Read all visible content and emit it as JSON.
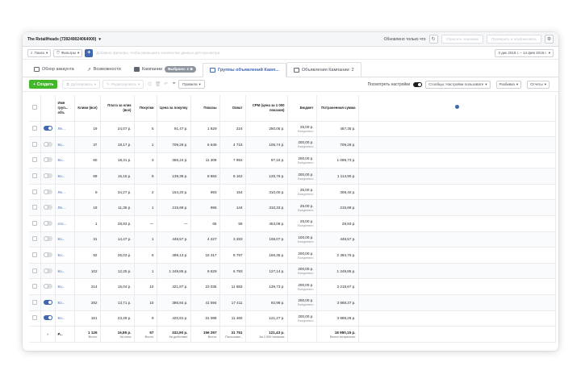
{
  "topbar": {
    "account": "The RetailHeads (739249024064000)",
    "changes_label": "Обновлено только что",
    "discard_label": "Сбросить черновик",
    "publish_label": "Проверить и опубликовать"
  },
  "filterbar": {
    "search_label": "Поиск",
    "filters_label": "Фильтры",
    "hint": "Добавьте фильтры, чтобы уменьшить количество данных для просмотра",
    "date_range": "3 дек 2018 г. – 14 фев 2019 г."
  },
  "tabs": {
    "overview": "Обзор аккаунта",
    "opportunities": "Возможности",
    "campaigns": "Кампании",
    "selected_badge": "Выбрано: 2",
    "adsets": "Группы объявлений Камп...",
    "ads": "Объявления Кампании: 2"
  },
  "toolbar": {
    "create": "Создать",
    "duplicate": "Дублировать",
    "edit": "Редактировать",
    "rules": "Правила",
    "view_settings": "Посмотреть настройки",
    "columns": "Столбцы: Настройки пользовате",
    "breakdown": "Разбивка",
    "reports": "Отчеты"
  },
  "columns": {
    "name": "Имя груп... объ",
    "clicks": "Клики (все)",
    "cpc": "Плата за клик (все)",
    "purchases": "Покупки",
    "cost_per_purchase": "Цена за покупку",
    "impressions": "Показы",
    "reach": "Охват",
    "cpm": "CPM (цена за 1 000 показов)",
    "budget": "Бюджет",
    "spent": "Потраченная сумма"
  },
  "rows": [
    {
      "on": false,
      "name": "Ле...",
      "clicks": "19",
      "cpc": "24,07 р.",
      "purchases": "5",
      "cpp": "91,47 р.",
      "impressions": "1 829",
      "reach": "224",
      "cpm": "250,05 р.",
      "budget": "25,00 р.",
      "budget_sub": "Ежедневно",
      "spent": "457,35 р."
    },
    {
      "on": false,
      "name": "Ко...",
      "clicks": "37",
      "cpc": "19,17 р.",
      "purchases": "1",
      "cpp": "709,28 р.",
      "impressions": "6 646",
      "reach": "4 715",
      "cpm": "106,74 р.",
      "budget": "200,00 р.",
      "budget_sub": "Ежедневно",
      "spent": "709,28 р."
    },
    {
      "on": false,
      "name": "Ко...",
      "clicks": "60",
      "cpc": "18,31 р.",
      "purchases": "3",
      "cpp": "366,24 р.",
      "impressions": "11 309",
      "reach": "7 992",
      "cpm": "97,16 р.",
      "budget": "200,00 р.",
      "budget_sub": "Ежедневно",
      "spent": "1 098,73 р."
    },
    {
      "on": false,
      "name": "Ко...",
      "clicks": "69",
      "cpc": "16,16 р.",
      "purchases": "8",
      "cpp": "139,38 р.",
      "impressions": "8 884",
      "reach": "6 162",
      "cpm": "125,76 р.",
      "budget": "200,00 р.",
      "budget_sub": "Ежедневно",
      "spent": "1 114,90 р."
    },
    {
      "on": false,
      "name": "Ле...",
      "clicks": "9",
      "cpc": "34,27 р.",
      "purchases": "2",
      "cpp": "154,20 р.",
      "impressions": "993",
      "reach": "154",
      "cpm": "310,00 р.",
      "budget": "25,00 р.",
      "budget_sub": "Ежедневно",
      "spent": "308,40 р."
    },
    {
      "on": false,
      "name": "Ле...",
      "clicks": "19",
      "cpc": "11,35 р.",
      "purchases": "1",
      "cpp": "215,69 р.",
      "impressions": "695",
      "reach": "144",
      "cpm": "310,33 р.",
      "budget": "25,00 р.",
      "budget_sub": "Ежедневно",
      "spent": "215,69 р."
    },
    {
      "on": false,
      "name": "ото...",
      "clicks": "1",
      "cpc": "28,93 р.",
      "purchases": "—",
      "cpp": "—",
      "impressions": "65",
      "reach": "59",
      "cpm": "453,08 р.",
      "budget": "25,00 р.",
      "budget_sub": "Ежедневно",
      "spent": "28,93 р."
    },
    {
      "on": false,
      "name": "Ко...",
      "clicks": "31",
      "cpc": "14,47 р.",
      "purchases": "1",
      "cpp": "448,57 р.",
      "impressions": "4 227",
      "reach": "3 283",
      "cpm": "106,07 р.",
      "budget": "100,00 р.",
      "budget_sub": "Ежедневно",
      "spent": "448,57 р."
    },
    {
      "on": false,
      "name": "Ко...",
      "clicks": "92",
      "cpc": "26,03 р.",
      "purchases": "6",
      "cpp": "399,13 р.",
      "impressions": "15 317",
      "reach": "8 797",
      "cpm": "156,35 р.",
      "budget": "200,00 р.",
      "budget_sub": "Ежедневно",
      "spent": "2 394,76 р."
    },
    {
      "on": false,
      "name": "Ко...",
      "clicks": "102",
      "cpc": "12,25 р.",
      "purchases": "1",
      "cpp": "1 249,85 р.",
      "impressions": "9 829",
      "reach": "6 793",
      "cpm": "127,14 р.",
      "budget": "200,00 р.",
      "budget_sub": "Ежедневно",
      "spent": "1 249,85 р."
    },
    {
      "on": false,
      "name": "Ко...",
      "clicks": "214",
      "cpc": "15,04 р.",
      "purchases": "10",
      "cpp": "321,87 р.",
      "impressions": "23 035",
      "reach": "11 883",
      "cpm": "139,73 р.",
      "budget": "200,00 р.",
      "budget_sub": "Ежедневно",
      "spent": "3 218,67 р."
    },
    {
      "on": true,
      "name": "Ко...",
      "clicks": "282",
      "cpc": "13,71 р.",
      "purchases": "10",
      "cpp": "386,84 р.",
      "impressions": "41 594",
      "reach": "17 411",
      "cpm": "92,98 р.",
      "budget": "200,00 р.",
      "budget_sub": "Ежедневно",
      "spent": "3 868,37 р."
    },
    {
      "on": true,
      "name": "Ко...",
      "clicks": "161",
      "cpc": "23,28 р.",
      "purchases": "9",
      "cpp": "420,81 р.",
      "impressions": "31 089",
      "reach": "11 460",
      "cpm": "121,27 р.",
      "budget": "200,00 р.",
      "budget_sub": "Ежедневно",
      "spent": "3 888,28 р."
    }
  ],
  "first_row_on": true,
  "totals": {
    "label": "Р...",
    "clicks": "1 126",
    "clicks_sub": "Всего",
    "cpc": "16,85 р.",
    "cpc_sub": "За клик",
    "purchases": "57",
    "purchases_sub": "Всего",
    "cpp": "332,90 р.",
    "cpp_sub": "За действие",
    "impressions": "156 297",
    "impressions_sub": "Всего",
    "reach": "31 751",
    "reach_sub": "Пользова...",
    "cpm": "121,43 р.",
    "cpm_sub": "За 1 000 показов",
    "spent": "18 980,15 р.",
    "spent_sub": "Всего потрачено"
  },
  "colors": {
    "accent": "#4267b2",
    "create": "#42b72a"
  }
}
